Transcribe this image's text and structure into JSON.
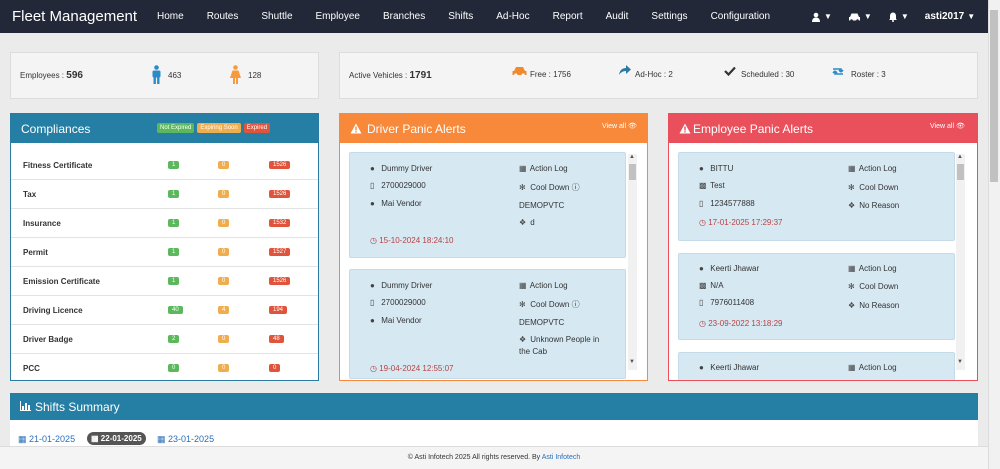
{
  "app": {
    "brand": "Fleet Management"
  },
  "nav": {
    "items": [
      "Home",
      "Routes",
      "Shuttle",
      "Employee",
      "Branches",
      "Shifts",
      "Ad-Hoc",
      "Report",
      "Audit",
      "Settings",
      "Configuration"
    ],
    "user": "asti2017"
  },
  "stats": {
    "employees_label": "Employees :",
    "employees_value": "596",
    "male_count": "463",
    "female_count": "128",
    "active_label": "Active Vehicles :",
    "active_value": "1791",
    "free": "Free : 1756",
    "adhoc": "Ad-Hoc : 2",
    "scheduled": "Scheduled : 30",
    "roster": "Roster : 3"
  },
  "compliances": {
    "title": "Compliances",
    "legend": [
      "Not Expired",
      "Expiring Soon",
      "Expired"
    ],
    "rows": [
      {
        "label": "Fitness Certificate",
        "ok": "1",
        "soon": "0",
        "expired": "1526"
      },
      {
        "label": "Tax",
        "ok": "1",
        "soon": "0",
        "expired": "1526"
      },
      {
        "label": "Insurance",
        "ok": "1",
        "soon": "0",
        "expired": "1532"
      },
      {
        "label": "Permit",
        "ok": "1",
        "soon": "0",
        "expired": "1527"
      },
      {
        "label": "Emission Certificate",
        "ok": "1",
        "soon": "0",
        "expired": "1526"
      },
      {
        "label": "Driving Licence",
        "ok": "40",
        "soon": "4",
        "expired": "194"
      },
      {
        "label": "Driver Badge",
        "ok": "2",
        "soon": "0",
        "expired": "48"
      },
      {
        "label": "PCC",
        "ok": "0",
        "soon": "0",
        "expired": "0"
      }
    ]
  },
  "driver_alerts": {
    "title": "Driver Panic Alerts",
    "view_all": "View all",
    "cards": [
      {
        "name": "Dummy Driver",
        "phone": "2700029000",
        "vendor": "Mai Vendor",
        "action": "Action Log",
        "cool": "Cool Down",
        "org": "DEMOPVTC",
        "reason": "d",
        "date": "15-10-2024 18:24:10"
      },
      {
        "name": "Dummy Driver",
        "phone": "2700029000",
        "vendor": "Mai Vendor",
        "action": "Action Log",
        "cool": "Cool Down",
        "org": "DEMOPVTC",
        "reason": "Unknown People in",
        "reason2": "the Cab",
        "date": "19-04-2024 12:55:07"
      }
    ]
  },
  "employee_alerts": {
    "title": "Employee Panic Alerts",
    "view_all": "View all",
    "cards": [
      {
        "name": "BITTU",
        "vehicle": "Test",
        "phone": "1234577888",
        "action": "Action Log",
        "cool": "Cool Down",
        "reason": "No Reason",
        "date": "17-01-2025 17:29:37"
      },
      {
        "name": "Keerti Jhawar",
        "vehicle": "N/A",
        "phone": "7976011408",
        "action": "Action Log",
        "cool": "Cool Down",
        "reason": "No Reason",
        "date": "23-09-2022 13:18:29"
      },
      {
        "name": "Keerti Jhawar",
        "action": "Action Log"
      }
    ]
  },
  "shifts": {
    "title": "Shifts Summary",
    "dates": [
      "21-01-2025",
      "22-01-2025",
      "23-01-2025"
    ]
  },
  "footer": {
    "text": "© Asti Infotech 2025 All rights reserved. By",
    "link": "Asti Infotech"
  },
  "colors": {
    "navbar": "#232838",
    "blue": "#257ea3",
    "orange": "#f8893b",
    "red": "#e9505b"
  }
}
